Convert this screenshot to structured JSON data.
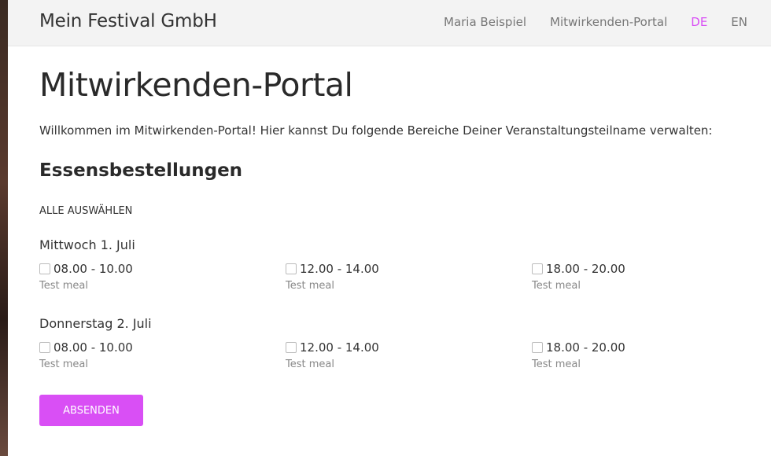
{
  "navbar": {
    "brand": "Mein Festival GmbH",
    "user": "Maria Beispiel",
    "portal": "Mitwirkenden-Portal",
    "lang_de": "DE",
    "lang_en": "EN"
  },
  "colors": {
    "accent": "#d94ff5",
    "navbar_bg": "#f3f3f3"
  },
  "main": {
    "title": "Mitwirkenden-Portal",
    "intro": "Willkommen im Mitwirkenden-Portal! Hier kannst Du folgende Bereiche Deiner Veranstaltungsteilname verwalten:",
    "section_title": "Essensbestellungen",
    "select_all": "ALLE AUSWÄHLEN",
    "days": [
      {
        "title": "Mittwoch 1. Juli",
        "slots": [
          {
            "time": "08.00 - 10.00",
            "meal": "Test meal",
            "checked": false
          },
          {
            "time": "12.00 - 14.00",
            "meal": "Test meal",
            "checked": false
          },
          {
            "time": "18.00 - 20.00",
            "meal": "Test meal",
            "checked": false
          }
        ]
      },
      {
        "title": "Donnerstag 2. Juli",
        "slots": [
          {
            "time": "08.00 - 10.00",
            "meal": "Test meal",
            "checked": false
          },
          {
            "time": "12.00 - 14.00",
            "meal": "Test meal",
            "checked": false
          },
          {
            "time": "18.00 - 20.00",
            "meal": "Test meal",
            "checked": false
          }
        ]
      }
    ],
    "submit": "ABSENDEN"
  }
}
